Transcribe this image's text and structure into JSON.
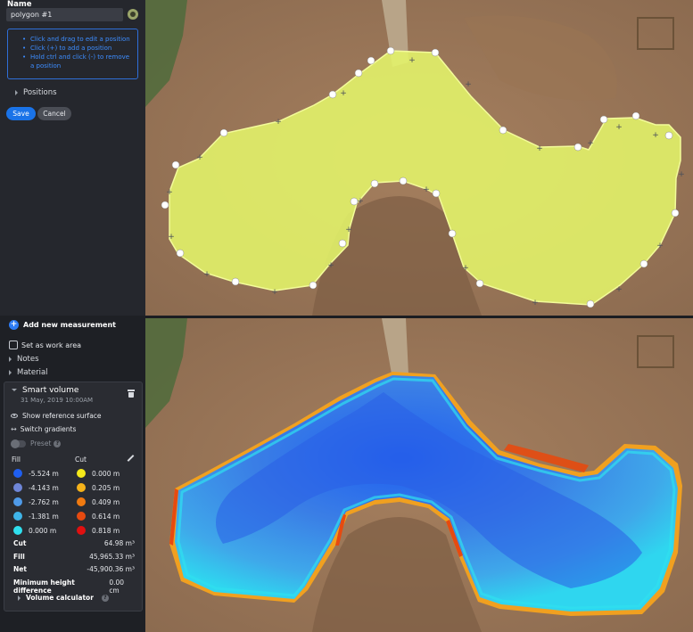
{
  "polygon_editor": {
    "name_label": "Name",
    "name_value": "polygon #1",
    "hints": [
      "Click and drag to edit a position",
      "Click (+) to add a position",
      "Hold ctrl and click (-) to remove a position"
    ],
    "positions_label": "Positions",
    "save_label": "Save",
    "cancel_label": "Cancel"
  },
  "measurement_panel": {
    "add_new_label": "Add new measurement",
    "work_area_label": "Set as work area",
    "notes_label": "Notes",
    "material_label": "Material"
  },
  "smart_volume": {
    "title": "Smart volume",
    "date": "31 May, 2019 10:00AM",
    "show_reference_label": "Show reference surface",
    "switch_gradients_label": "Switch gradients",
    "preset_label": "Preset",
    "fill_header": "Fill",
    "cut_header": "Cut",
    "fill_legend": [
      {
        "value": "-5.524 m",
        "color": "#1f5ff0"
      },
      {
        "value": "-4.143 m",
        "color": "#6f86d8"
      },
      {
        "value": "-2.762 m",
        "color": "#4f9ae8"
      },
      {
        "value": "-1.381 m",
        "color": "#3fb4e8"
      },
      {
        "value": "0.000 m",
        "color": "#2fe0ef"
      }
    ],
    "cut_legend": [
      {
        "value": "0.000 m",
        "color": "#f5e91a"
      },
      {
        "value": "0.205 m",
        "color": "#f5b21a"
      },
      {
        "value": "0.409 m",
        "color": "#f07a10"
      },
      {
        "value": "0.614 m",
        "color": "#e64a10"
      },
      {
        "value": "0.818 m",
        "color": "#e01010"
      }
    ],
    "stats": {
      "cut_label": "Cut",
      "cut_value": "64.98 m³",
      "fill_label": "Fill",
      "fill_value": "45,965.33 m³",
      "net_label": "Net",
      "net_value": "-45,900.36 m³",
      "min_height_label": "Minimum height difference",
      "min_height_value": "0.00 cm"
    },
    "volume_calculator_label": "Volume calculator"
  },
  "colors": {
    "accent": "#1a73e8",
    "polygon_fill": "#e4f56a",
    "panel_bg": "#25272d"
  }
}
